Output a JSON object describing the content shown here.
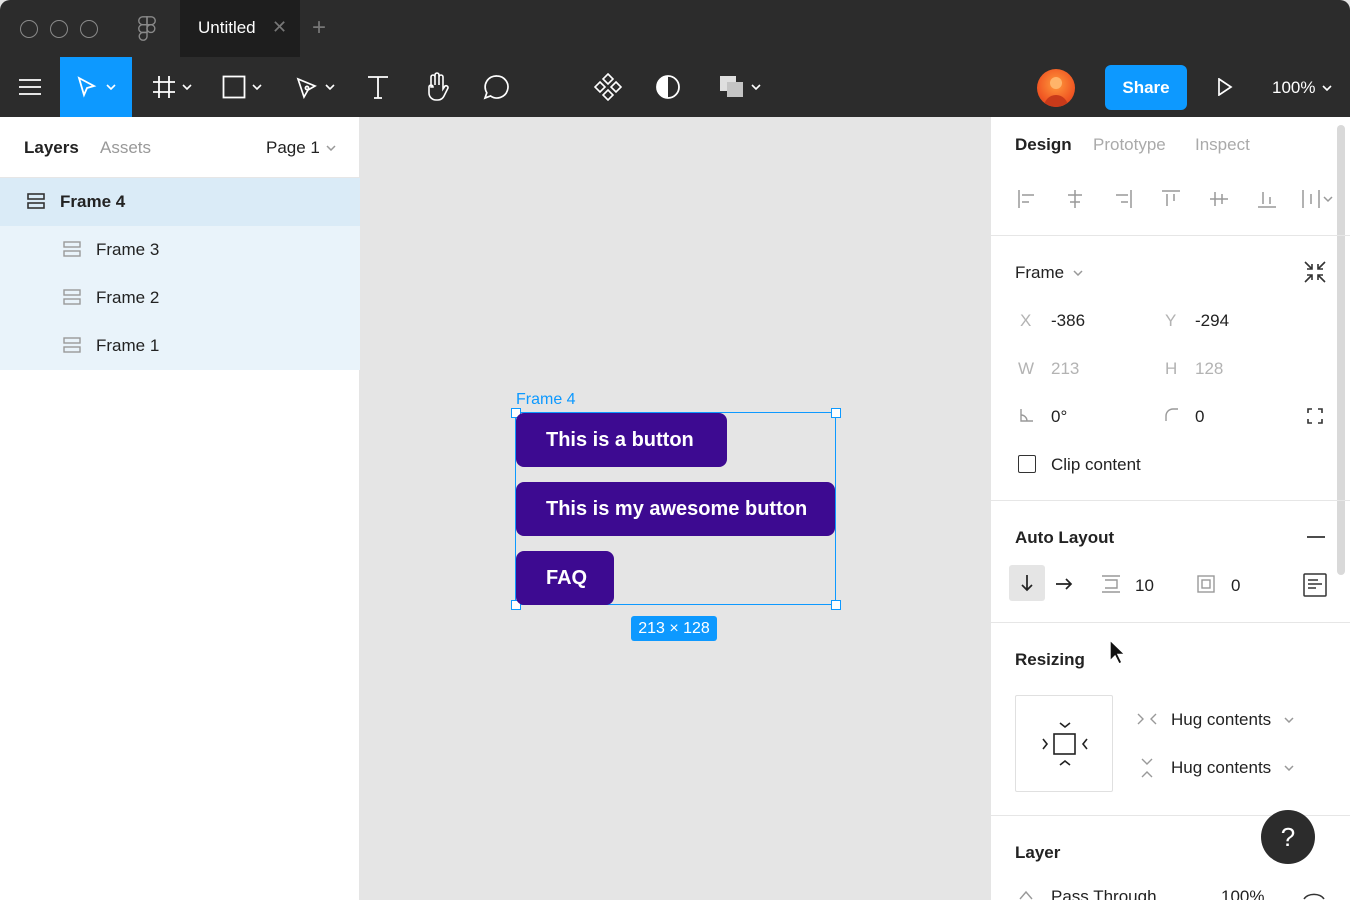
{
  "window": {
    "tab_title": "Untitled",
    "tab_close": "✕",
    "new_tab": "+"
  },
  "toolbar": {
    "share_label": "Share",
    "zoom": "100%",
    "text_tool": "T"
  },
  "layers_panel": {
    "tabs": {
      "layers": "Layers",
      "assets": "Assets"
    },
    "page": "Page 1",
    "items": [
      {
        "name": "Frame 4",
        "level": 0,
        "selected": true
      },
      {
        "name": "Frame 3",
        "level": 1
      },
      {
        "name": "Frame 2",
        "level": 1
      },
      {
        "name": "Frame 1",
        "level": 1
      }
    ]
  },
  "canvas": {
    "frame_label": "Frame 4",
    "buttons": [
      "This is  a button",
      "This is my awesome button",
      "FAQ"
    ],
    "size_badge": "213 × 128",
    "button_color": "#3d0a91",
    "accent": "#0d99ff"
  },
  "design_panel": {
    "tabs": {
      "design": "Design",
      "prototype": "Prototype",
      "inspect": "Inspect"
    },
    "frame_type": "Frame",
    "x_label": "X",
    "x": "-386",
    "y_label": "Y",
    "y": "-294",
    "w_label": "W",
    "w": "213",
    "h_label": "H",
    "h": "128",
    "rotation": "0°",
    "radius": "0",
    "clip_content": "Clip content",
    "auto_layout": {
      "title": "Auto Layout",
      "spacing": "10",
      "padding": "0"
    },
    "resizing": {
      "title": "Resizing",
      "horizontal": "Hug contents",
      "vertical": "Hug contents"
    },
    "layer": {
      "title": "Layer",
      "blend": "Pass Through",
      "opacity": "100%"
    },
    "help": "?"
  }
}
